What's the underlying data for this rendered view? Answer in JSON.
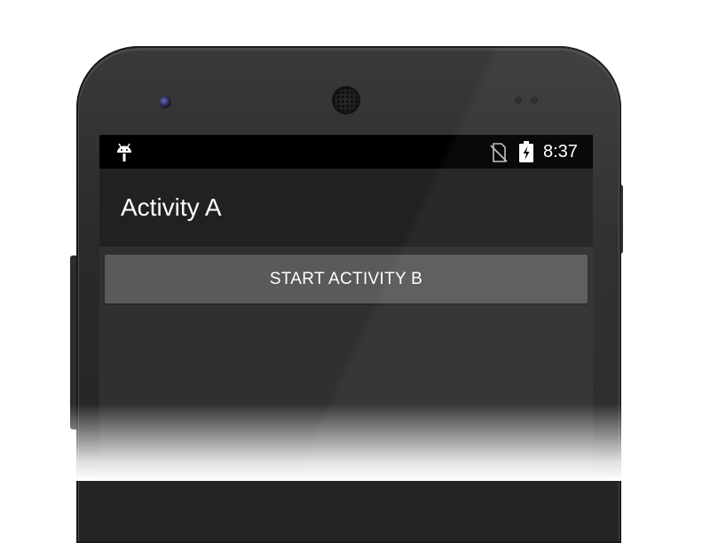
{
  "status_bar": {
    "time": "8:37",
    "left_icon": "android-icon",
    "right_icons": [
      "no-sim-icon",
      "battery-charging-icon"
    ]
  },
  "app_bar": {
    "title": "Activity A"
  },
  "main": {
    "button_label": "START ACTIVITY B"
  },
  "colors": {
    "status_bar": "#000000",
    "app_bar": "#212121",
    "background": "#303030",
    "button": "#5a5a5a",
    "text": "#ffffff"
  }
}
